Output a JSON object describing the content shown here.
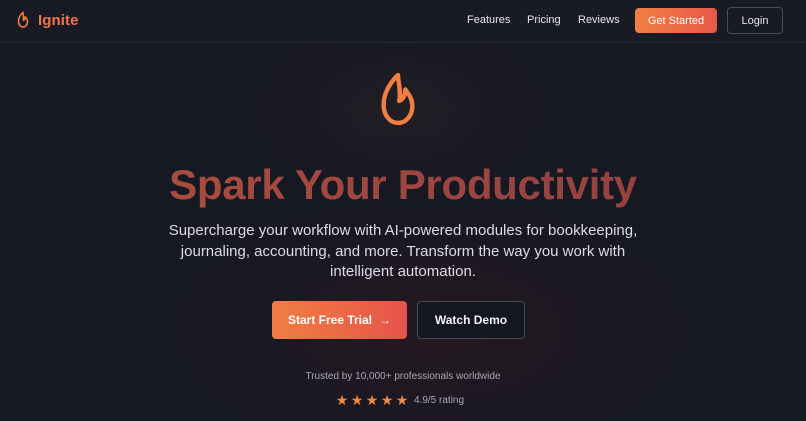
{
  "nav": {
    "brand": "Ignite",
    "brand_icon": "flame-icon",
    "links": [
      "Features",
      "Pricing",
      "Reviews"
    ],
    "get_started_label": "Get Started",
    "login_label": "Login"
  },
  "hero": {
    "icon": "flame-icon",
    "headline": "Spark Your Productivity",
    "subtitle": "Supercharge your workflow with AI-powered modules for bookkeeping, journaling, accounting, and more. Transform the way you work with intelligent automation.",
    "primary_cta": "Start Free Trial",
    "primary_cta_icon": "arrow-right-icon",
    "secondary_cta": "Watch Demo",
    "trusted_text": "Trusted by 10,000+ professionals worldwide",
    "rating_text": "4.9/5 rating",
    "stars_filled": 5,
    "stars_total": 5
  },
  "colors": {
    "accent": "#f07f42",
    "accent_end": "#e6524b",
    "background": "#161822",
    "brand_text": "#f0744a"
  }
}
